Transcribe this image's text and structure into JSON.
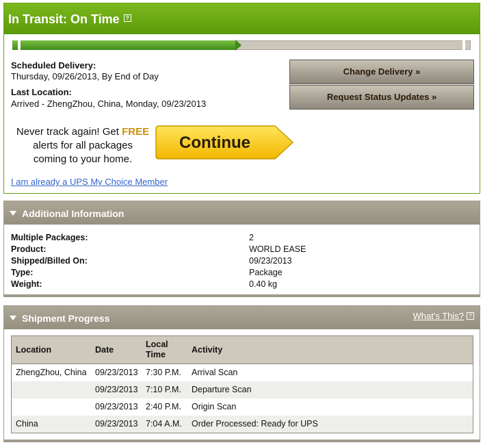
{
  "status": {
    "title": "In Transit: On Time",
    "progress_fraction": 0.5,
    "scheduled_delivery_label": "Scheduled Delivery:",
    "scheduled_delivery_value": "Thursday, 09/26/2013, By End of Day",
    "last_location_label": "Last Location:",
    "last_location_value": "Arrived - ZhengZhou, China, Monday, 09/23/2013",
    "change_delivery_label": "Change Delivery »",
    "request_updates_label": "Request Status Updates »",
    "promo_line1_a": "Never track again! Get ",
    "promo_line1_free": "FREE",
    "promo_line2": "alerts for all packages",
    "promo_line3": "coming to your home.",
    "continue_label": "Continue",
    "member_link": "I am already a UPS My Choice Member",
    "help_glyph": "?"
  },
  "additional": {
    "title": "Additional Information",
    "rows": [
      {
        "label": "Multiple Packages:",
        "value": "2"
      },
      {
        "label": "Product:",
        "value": "WORLD EASE"
      },
      {
        "label": "Shipped/Billed On:",
        "value": "09/23/2013"
      },
      {
        "label": "Type:",
        "value": "Package"
      },
      {
        "label": "Weight:",
        "value": "0.40 kg"
      }
    ]
  },
  "shipment_progress": {
    "title": "Shipment Progress",
    "whats_this": "What's This?",
    "columns": {
      "location": "Location",
      "date": "Date",
      "time_line1": "Local",
      "time_line2": "Time",
      "activity": "Activity"
    },
    "rows": [
      {
        "location": "ZhengZhou, China",
        "date": "09/23/2013",
        "time": "7:30 P.M.",
        "activity": "Arrival Scan"
      },
      {
        "location": "",
        "date": "09/23/2013",
        "time": "7:10 P.M.",
        "activity": "Departure Scan"
      },
      {
        "location": "",
        "date": "09/23/2013",
        "time": "2:40 P.M.",
        "activity": "Origin Scan"
      },
      {
        "location": "China",
        "date": "09/23/2013",
        "time": "7:04 A.M.",
        "activity": "Order Processed: Ready for UPS"
      }
    ]
  },
  "colors": {
    "header_green": "#6aa012",
    "section_taupe": "#a09a8e",
    "continue_yellow": "#f5c400",
    "free_gold": "#c9900c",
    "link_blue": "#3366cc"
  }
}
